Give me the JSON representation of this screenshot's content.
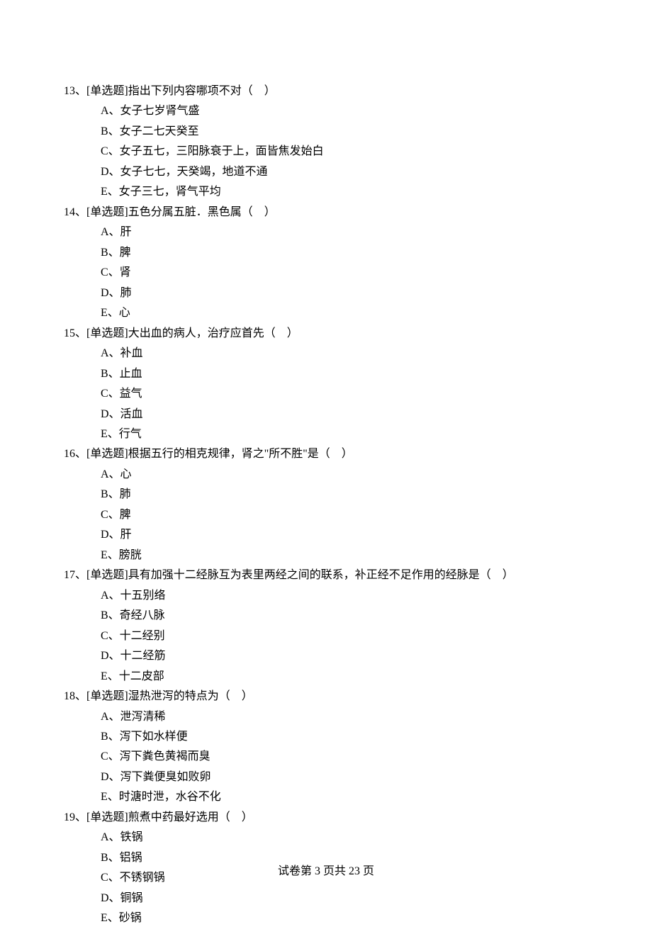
{
  "questions": [
    {
      "number": "13、",
      "type": "[单选题]",
      "stem": "指出下列内容哪项不对（　）",
      "options": [
        "A、女子七岁肾气盛",
        "B、女子二七天癸至",
        "C、女子五七，三阳脉衰于上，面皆焦发始白",
        "D、女子七七，天癸竭，地道不通",
        "E、女子三七，肾气平均"
      ]
    },
    {
      "number": "14、",
      "type": "[单选题]",
      "stem": "五色分属五脏．黑色属（　）",
      "options": [
        "A、肝",
        "B、脾",
        "C、肾",
        "D、肺",
        "E、心"
      ]
    },
    {
      "number": "15、",
      "type": "[单选题]",
      "stem": "大出血的病人，治疗应首先（　）",
      "options": [
        "A、补血",
        "B、止血",
        "C、益气",
        "D、活血",
        "E、行气"
      ]
    },
    {
      "number": "16、",
      "type": "[单选题]",
      "stem": "根据五行的相克规律，肾之\"所不胜\"是（　）",
      "options": [
        "A、心",
        "B、肺",
        "C、脾",
        "D、肝",
        "E、膀胱"
      ]
    },
    {
      "number": "17、",
      "type": "[单选题]",
      "stem": "具有加强十二经脉互为表里两经之间的联系，补正经不足作用的经脉是（　）",
      "options": [
        "A、十五别络",
        "B、奇经八脉",
        "C、十二经别",
        "D、十二经筋",
        "E、十二皮部"
      ]
    },
    {
      "number": "18、",
      "type": "[单选题]",
      "stem": "湿热泄泻的特点为（　）",
      "options": [
        "A、泄泻清稀",
        "B、泻下如水样便",
        "C、泻下粪色黄褐而臭",
        "D、泻下粪便臭如败卵",
        "E、时溏时泄，水谷不化"
      ]
    },
    {
      "number": "19、",
      "type": "[单选题]",
      "stem": "煎煮中药最好选用（　）",
      "options": [
        "A、铁锅",
        "B、铝锅",
        "C、不锈钢锅",
        "D、铜锅",
        "E、砂锅"
      ]
    }
  ],
  "footer": "试卷第 3 页共 23 页"
}
